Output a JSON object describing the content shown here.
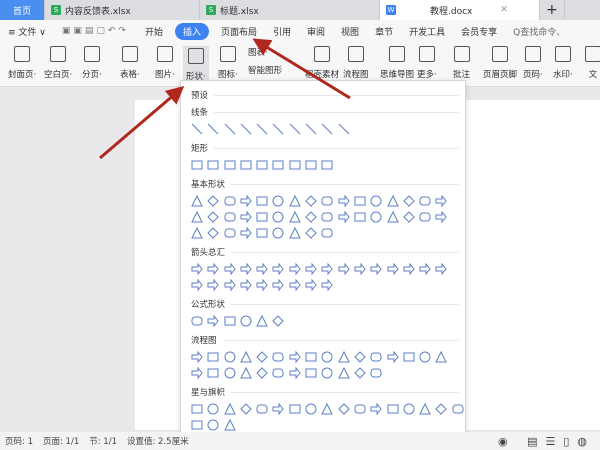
{
  "tabs": [
    {
      "label": "首页"
    },
    {
      "label": "内容反馈表.xlsx",
      "icon": "S"
    },
    {
      "label": "标题.xlsx",
      "icon": "S"
    },
    {
      "label": "教程.docx",
      "icon": "W"
    }
  ],
  "new_tab": "+",
  "menu": {
    "file": "≡ 文件 ∨",
    "items": [
      "开始",
      "插入",
      "页面布局",
      "引用",
      "审阅",
      "视图",
      "章节",
      "开发工具",
      "会员专享"
    ],
    "search": "Q查找命令、"
  },
  "ribbon": [
    "封面页·",
    "空白页·",
    "分页·",
    "表格·",
    "图片·",
    "形状·",
    "图标·",
    "图表·",
    "智能图形",
    "稻壳素材",
    "流程图",
    "思维导图",
    "更多·",
    "批注",
    "页眉页脚",
    "页码·",
    "水印·",
    "文"
  ],
  "panel": {
    "title": "预设",
    "sections": [
      {
        "label": "线条",
        "rows": [
          10
        ]
      },
      {
        "label": "矩形",
        "rows": [
          9
        ]
      },
      {
        "label": "基本形状",
        "rows": [
          16,
          16,
          9
        ]
      },
      {
        "label": "箭头总汇",
        "rows": [
          16,
          9
        ]
      },
      {
        "label": "公式形状",
        "rows": [
          6
        ]
      },
      {
        "label": "流程图",
        "rows": [
          16,
          12
        ]
      },
      {
        "label": "星与旗帜",
        "rows": [
          17,
          3
        ]
      }
    ]
  },
  "status": [
    "页码: 1",
    "页面: 1/1",
    "节: 1/1",
    "设置值: 2.5厘米"
  ],
  "colors": {
    "accent": "#3d82f0",
    "shape": "#5b7fc4",
    "arrow": "#b0281c"
  }
}
